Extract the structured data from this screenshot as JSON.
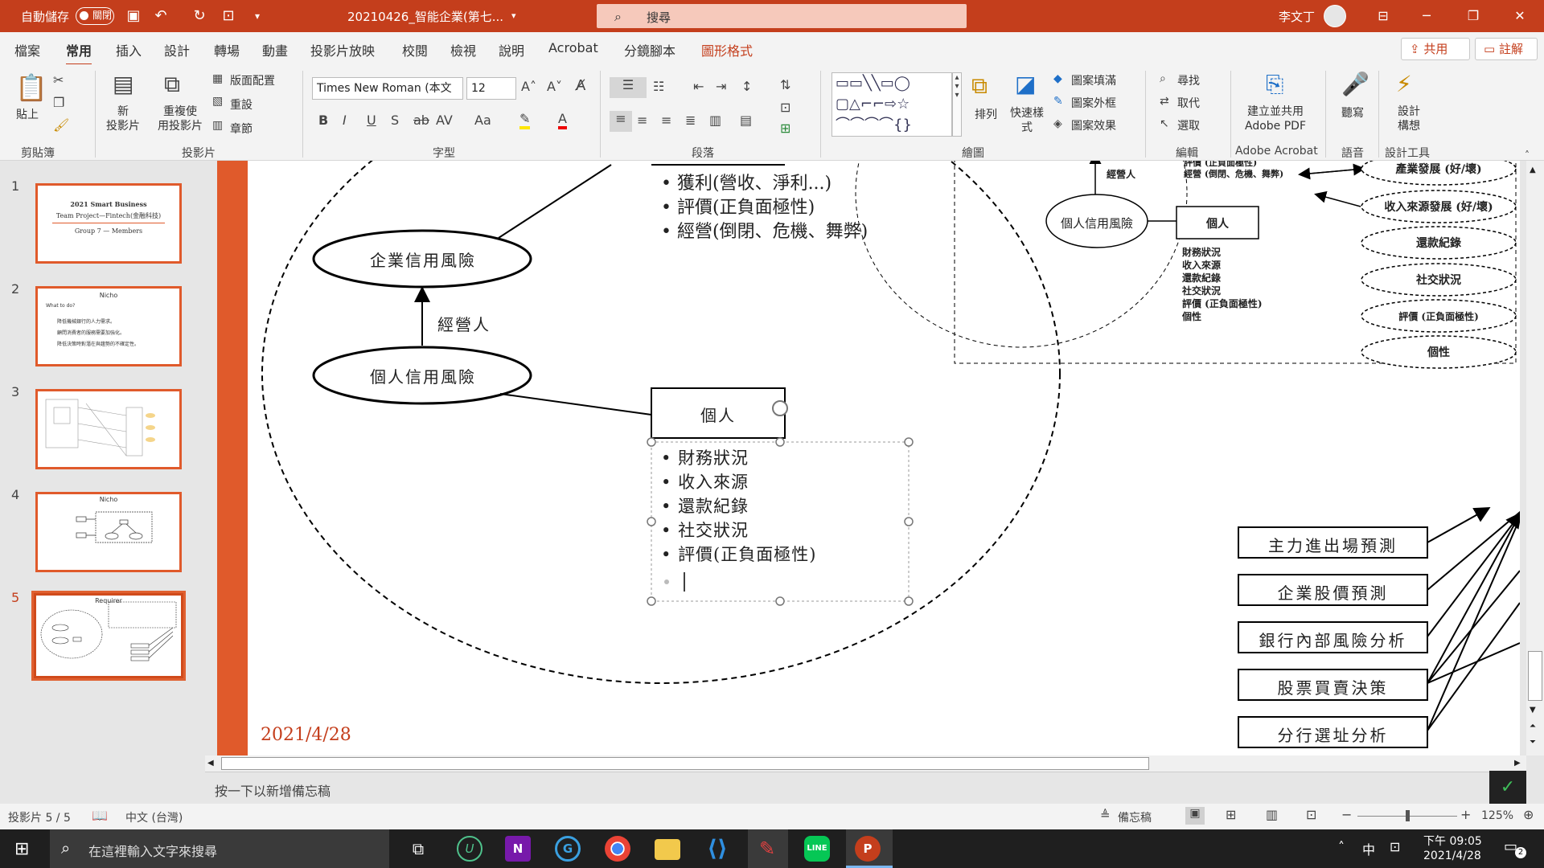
{
  "titlebar": {
    "autosave": "自動儲存",
    "autosave_state": "關閉",
    "filename": "20210426_智能企業(第七...",
    "search_placeholder": "搜尋",
    "user": "李文丁"
  },
  "menubar": {
    "tabs": [
      "檔案",
      "常用",
      "插入",
      "設計",
      "轉場",
      "動畫",
      "投影片放映",
      "校閱",
      "檢視",
      "說明",
      "Acrobat",
      "分鏡腳本",
      "圖形格式"
    ],
    "share": "共用",
    "comment": "註解"
  },
  "ribbon": {
    "clipboard": {
      "paste": "貼上",
      "group": "剪貼簿"
    },
    "slides": {
      "new_slide": "新\n投影片",
      "reuse": "重複使\n用投影片",
      "layout": "版面配置",
      "reset": "重設",
      "section": "章節",
      "group": "投影片"
    },
    "font": {
      "family": "Times New Roman (本文",
      "size": "12",
      "group": "字型"
    },
    "paragraph": {
      "group": "段落"
    },
    "drawing": {
      "arrange": "排列",
      "quick_styles": "快速樣\n式",
      "fill": "圖案填滿",
      "outline": "圖案外框",
      "effects": "圖案效果",
      "group": "繪圖"
    },
    "editing": {
      "find": "尋找",
      "replace": "取代",
      "select": "選取",
      "group": "編輯"
    },
    "acrobat": {
      "create": "建立並共用\nAdobe PDF",
      "group": "Adobe Acrobat"
    },
    "voice": {
      "dictate": "聽寫",
      "group": "語音"
    },
    "designer": {
      "ideas": "設計\n構想",
      "group": "設計工具"
    }
  },
  "thumbnails": [
    {
      "num": "1",
      "title": "2021 Smart Business",
      "sub": "Team Project—Fintech(金融科技)",
      "group": "Group 7 — Members"
    },
    {
      "num": "2",
      "title": "Nicho",
      "lines": [
        "What to do?",
        "降低機械銀行的人力需求。",
        "顧問消費者的服務需要加強化。",
        "降低決策時對潛在與趨勢的不確定性。"
      ]
    },
    {
      "num": "3"
    },
    {
      "num": "4",
      "title": "Nicho"
    },
    {
      "num": "5",
      "title": "Requirer"
    }
  ],
  "slide": {
    "top_bullets": [
      "獲利(營收、淨利...)",
      "評價(正負面極性)",
      "經營(倒閉、危機、舞弊)"
    ],
    "enterprise_risk": "企業信用風險",
    "operator": "經營人",
    "personal_risk": "個人信用風險",
    "individual": "個人",
    "individual_bullets": [
      "財務狀況",
      "收入來源",
      "還款紀錄",
      "社交狀況",
      "評價(正負面極性)"
    ],
    "date": "2021/4/28",
    "mini": {
      "operator": "經營人",
      "bullets_top": [
        "評價 (正負面極性)",
        "經營 (倒閉、危機、舞弊)"
      ],
      "personal_risk": "個人信用風險",
      "individual": "個人",
      "bullets": [
        "財務狀況",
        "收入來源",
        "還款紀錄",
        "社交狀況",
        "評價 (正負面極性)",
        "個性"
      ],
      "ellipses": [
        "產業發展 (好/壞)",
        "收入來源發展 (好/壞)",
        "還款紀錄",
        "社交狀況",
        "評價 (正負面極性)",
        "個性"
      ]
    },
    "right_boxes": [
      "主力進出場預測",
      "企業股價預測",
      "銀行內部風險分析",
      "股票買賣決策",
      "分行選址分析"
    ]
  },
  "notes_placeholder": "按一下以新增備忘稿",
  "status": {
    "slide": "投影片 5 / 5",
    "lang": "中文 (台灣)",
    "notes": "備忘稿",
    "zoom": "125%"
  },
  "taskbar": {
    "search": "在這裡輸入文字來搜尋",
    "ime": "中",
    "time": "下午 09:05",
    "date": "2021/4/28",
    "notif": "2"
  }
}
